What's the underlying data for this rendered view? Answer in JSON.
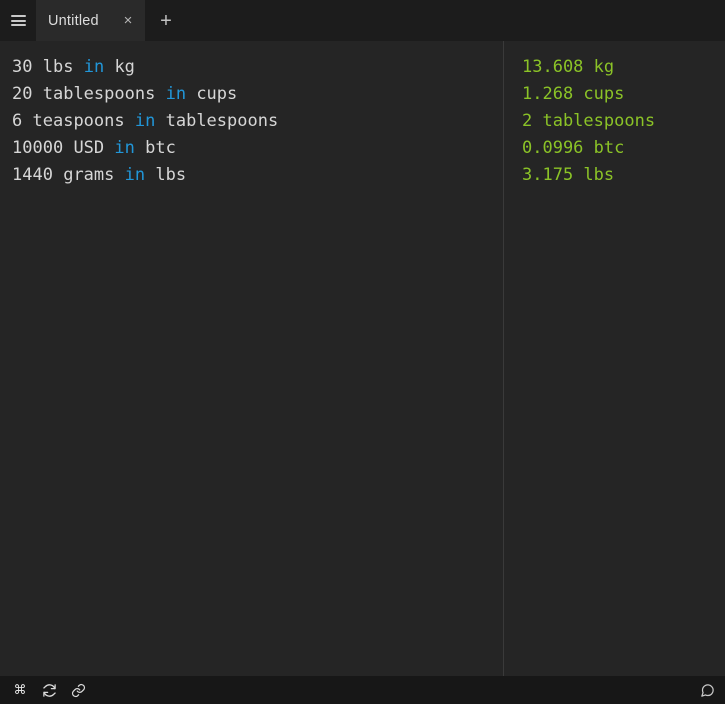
{
  "window": {
    "title": "Untitled"
  },
  "tabbar": {
    "menu_icon": "hamburger-menu-icon",
    "tab_label": "Untitled",
    "close_label": "×",
    "new_tab_label": "+"
  },
  "editor": {
    "lines": [
      {
        "value": "30",
        "unit": "lbs",
        "keyword": "in",
        "target": "kg"
      },
      {
        "value": "20",
        "unit": "tablespoons",
        "keyword": "in",
        "target": "cups"
      },
      {
        "value": "6",
        "unit": "teaspoons",
        "keyword": "in",
        "target": "tablespoons"
      },
      {
        "value": "10000",
        "unit": "USD",
        "keyword": "in",
        "target": "btc"
      },
      {
        "value": "1440",
        "unit": "grams",
        "keyword": "in",
        "target": "lbs"
      }
    ]
  },
  "results": {
    "lines": [
      "13.608 kg",
      "1.268 cups",
      "2 tablespoons",
      "0.0996 btc",
      "3.175 lbs"
    ]
  },
  "statusbar": {
    "icons": [
      {
        "name": "command-icon",
        "glyph": "⌘"
      },
      {
        "name": "refresh-icon",
        "glyph": ""
      },
      {
        "name": "link-icon",
        "glyph": ""
      }
    ],
    "comment_icon": "comment-icon"
  },
  "colors": {
    "background": "#252525",
    "tabbar": "#1c1c1c",
    "tab_active": "#2a2a2a",
    "statusbar": "#171717",
    "divider": "#3a3a3a",
    "text": "#d6d6d6",
    "keyword": "#2196d8",
    "result": "#8bc327"
  }
}
